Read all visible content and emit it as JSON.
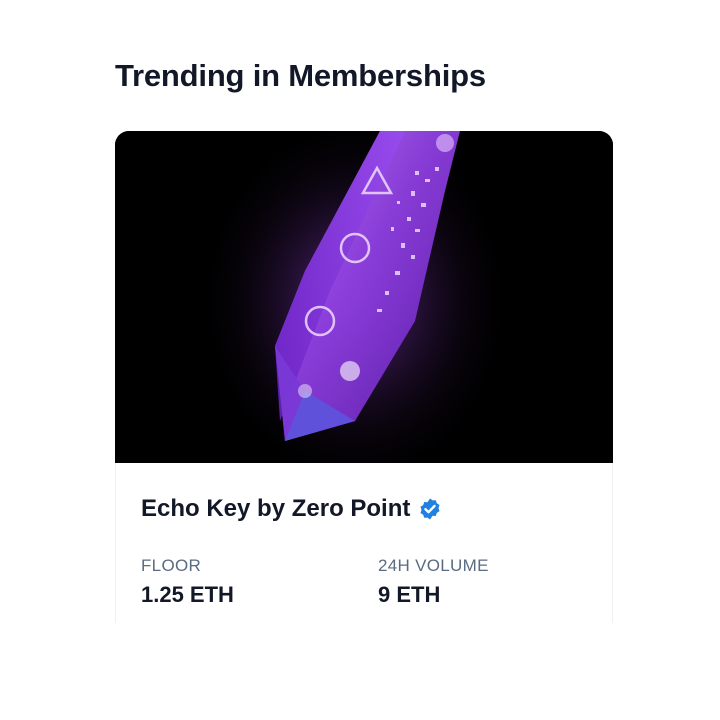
{
  "section": {
    "title": "Trending in Memberships"
  },
  "card": {
    "image": {
      "alt_icon": "crystal-key-artwork"
    },
    "name": "Echo Key by Zero Point",
    "verified_icon": "verified-badge-icon",
    "stats": [
      {
        "label": "FLOOR",
        "value": "1.25 ETH"
      },
      {
        "label": "24H VOLUME",
        "value": "9 ETH"
      }
    ]
  },
  "colors": {
    "text_primary": "#121827",
    "text_secondary": "#5b6b82",
    "verified_blue": "#2081e2",
    "crystal_purple": "#8b3fd9"
  }
}
